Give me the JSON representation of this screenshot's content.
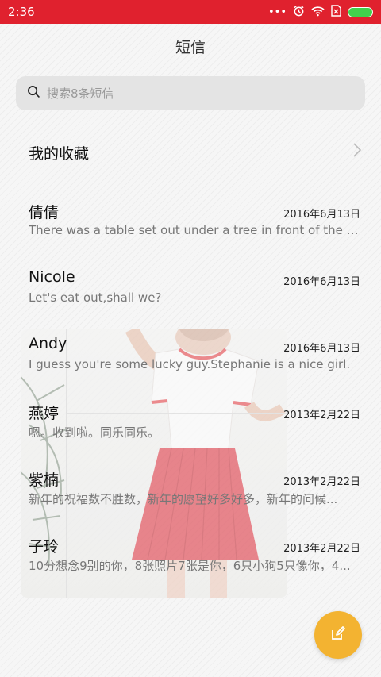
{
  "status_bar": {
    "time": "2:36"
  },
  "header": {
    "title": "短信"
  },
  "search": {
    "placeholder": "搜索8条短信"
  },
  "favorites": {
    "label": "我的收藏"
  },
  "conversations": [
    {
      "name": "倩倩",
      "date": "2016年6月13日",
      "preview": "There was a table set out under a tree in front of the ho..."
    },
    {
      "name": "Nicole",
      "date": "2016年6月13日",
      "preview": "Let's eat out,shall we?"
    },
    {
      "name": "Andy",
      "date": "2016年6月13日",
      "preview": "I guess you're some lucky guy.Stephanie is a nice girl."
    },
    {
      "name": "燕婷",
      "date": "2013年2月22日",
      "preview": "嗯。收到啦。同乐同乐。"
    },
    {
      "name": "紫楠",
      "date": "2013年2月22日",
      "preview": "新年的祝福数不胜数，新年的愿望好多好多，新年的问候..."
    },
    {
      "name": "子玲",
      "date": "2013年2月22日",
      "preview": "10分想念9别的你，8张照片7张是你，6只小狗5只像你，4..."
    }
  ],
  "icons": {
    "status": [
      "more-dots-icon",
      "alarm-icon",
      "wifi-icon",
      "sim-off-icon",
      "battery-icon"
    ],
    "search": "search-icon",
    "chevron": "chevron-right-icon",
    "compose": "compose-icon"
  },
  "colors": {
    "status_bar": "#e0212e",
    "fab": "#f3b331",
    "battery": "#42d04c"
  }
}
